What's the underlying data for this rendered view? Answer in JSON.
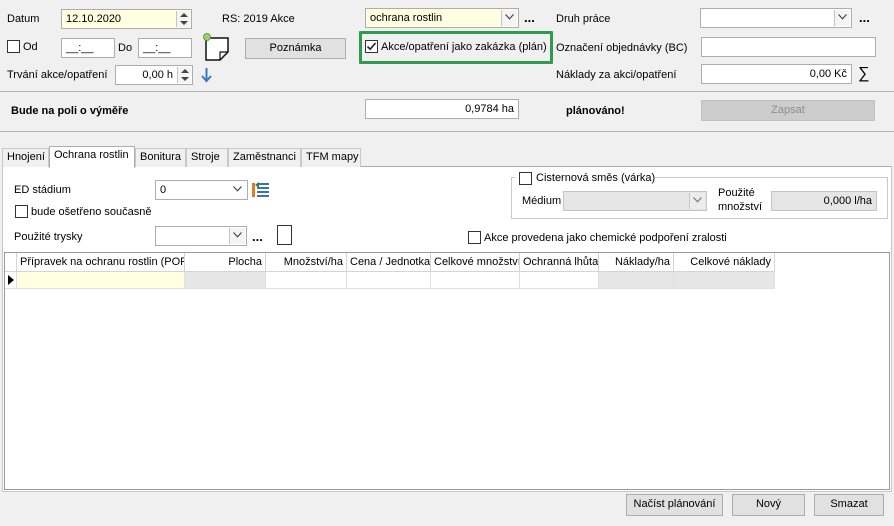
{
  "header": {
    "datum_label": "Datum",
    "datum_value": "12.10.2020",
    "rs_label": "RS: 2019 Akce",
    "akce_type_value": "ochrana rostlin",
    "druh_prace_label": "Druh práce",
    "druh_prace_value": "",
    "od_label": "Od",
    "od_value": "__:__",
    "do_label": "Do",
    "do_value": "__:__",
    "poznamka_label": "Poznámka",
    "zakazka_label": "Akce/opatření jako zakázka (plán)",
    "oznaceni_label": "Označení objednávky (BC)",
    "oznaceni_value": "",
    "trvani_label": "Trvání akce/opatření",
    "trvani_value": "0,00 h",
    "naklady_label": "Náklady za akci/opatření",
    "naklady_value": "0,00 Kč",
    "more_label": "..."
  },
  "summary": {
    "vymer_label": "Bude na poli o výměře",
    "vymer_value": "0,9784 ha",
    "planovano_label": "plánováno!",
    "zapsat_label": "Zapsat"
  },
  "tabs": [
    {
      "label": "Hnojení"
    },
    {
      "label": "Ochrana rostlin"
    },
    {
      "label": "Bonitura"
    },
    {
      "label": "Stroje"
    },
    {
      "label": "Zaměstnanci"
    },
    {
      "label": "TFM mapy"
    }
  ],
  "panel": {
    "ed_stadium_label": "ED stádium",
    "ed_stadium_value": "0",
    "soucasne_label": "bude ošetřeno současně",
    "trysky_label": "Použité trysky",
    "trysky_value": "",
    "cisterna_label": "Cisternová směs (várka)",
    "medium_label": "Médium",
    "medium_value": "",
    "pouzite_mnozstvi_label_1": "Použité",
    "pouzite_mnozstvi_label_2": "množství",
    "pouzite_mnozstvi_value": "0,000 l/ha",
    "chemicke_label": "Akce provedena jako chemické podpoření zralosti"
  },
  "grid": {
    "columns": [
      "Přípravek na ochranu rostlin (POR)",
      "Plocha",
      "Množství/ha",
      "Cena / Jednotka",
      "Celkové množství",
      "Ochranná lhůta",
      "Náklady/ha",
      "Celkové náklady"
    ]
  },
  "footer": {
    "nacist_label": "Načíst plánování",
    "novy_label": "Nový",
    "smazat_label": "Smazat"
  },
  "colors": {
    "highlight": "#2e9b4f",
    "input_yellow": "#ffffe1",
    "arrow_blue": "#3a78c8"
  }
}
